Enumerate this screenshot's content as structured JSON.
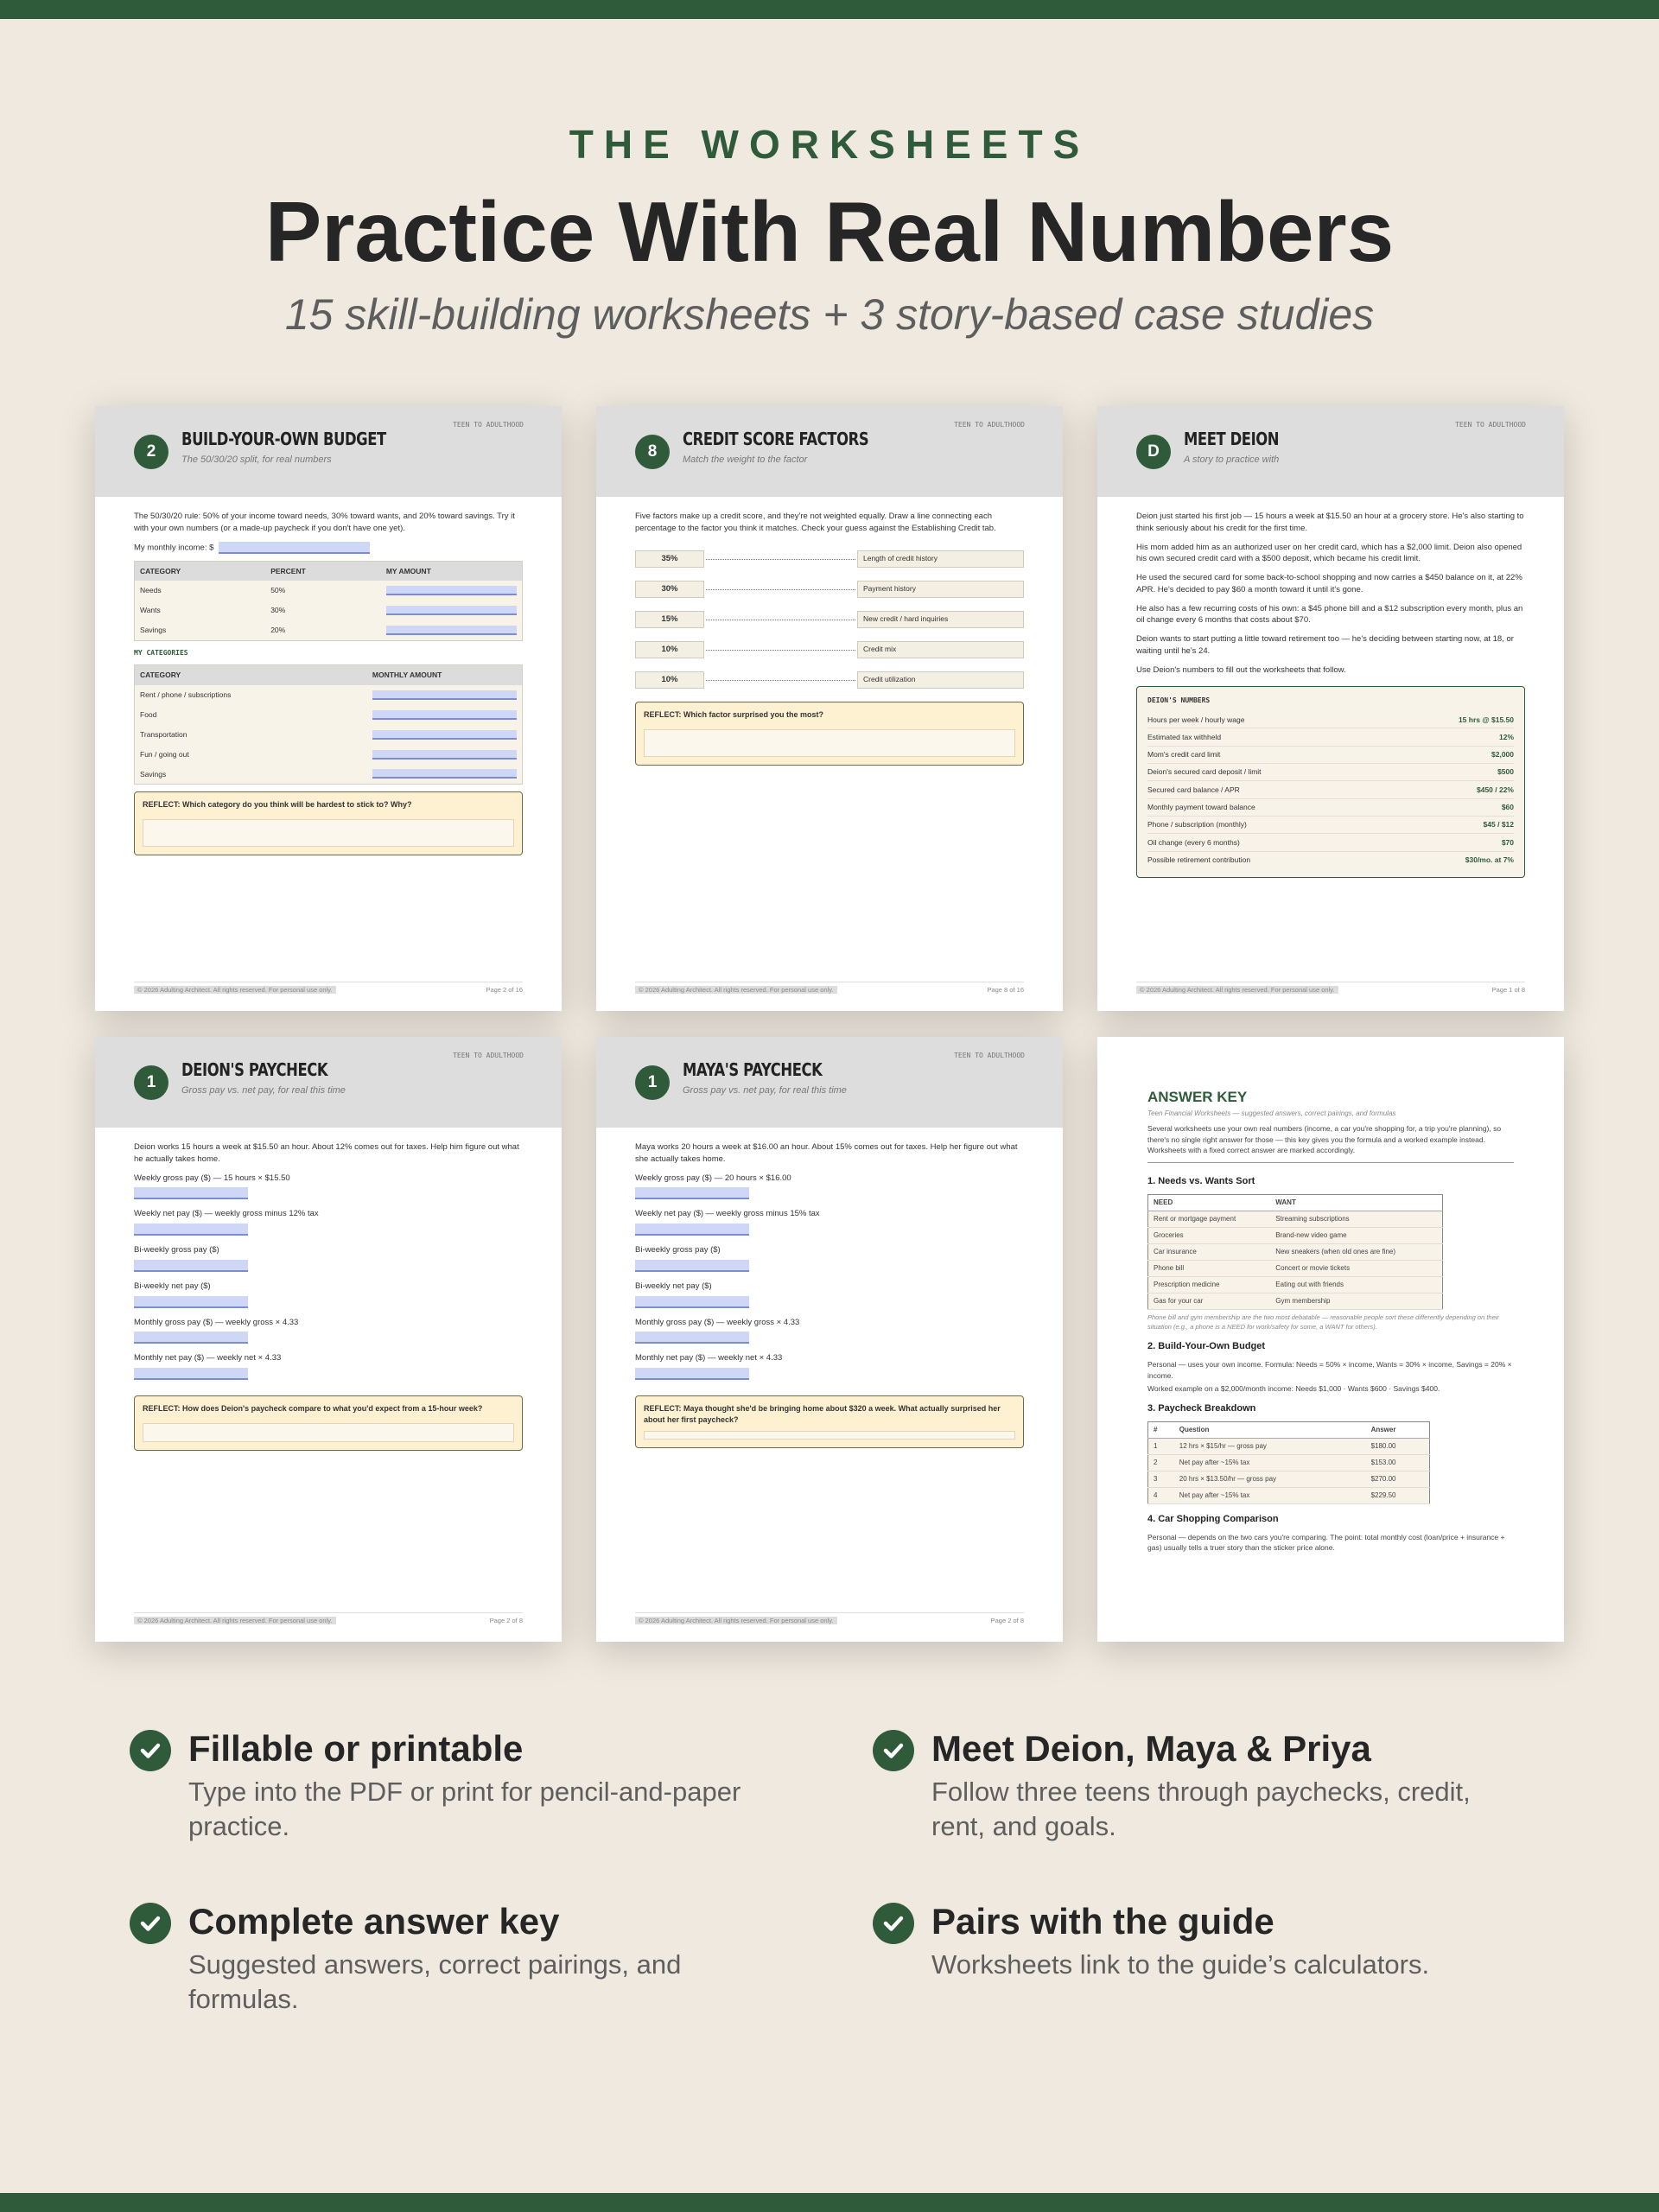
{
  "eyebrow": "THE WORKSHEETS",
  "headline": "Practice With Real Numbers",
  "subhead": "15 skill-building worksheets + 3 story-based case studies",
  "footer_copyright": "© 2026 Adulting Architect. All rights reserved. For personal use only.",
  "sheet_tag": "TEEN TO ADULTHOOD",
  "budget": {
    "badge": "2",
    "title": "BUILD-YOUR-OWN BUDGET",
    "subtitle": "The 50/30/20 split, for real numbers",
    "intro": "The 50/30/20 rule: 50% of your income toward needs, 30% toward wants, and 20% toward savings. Try it with your own numbers (or a made-up paycheck if you don't have one yet).",
    "income_label": "My monthly income: $",
    "col_category": "CATEGORY",
    "col_percent": "PERCENT",
    "col_amount": "MY AMOUNT",
    "rows": [
      {
        "cat": "Needs",
        "pct": "50%"
      },
      {
        "cat": "Wants",
        "pct": "30%"
      },
      {
        "cat": "Savings",
        "pct": "20%"
      }
    ],
    "my_categories": "MY CATEGORIES",
    "col_monthly": "MONTHLY AMOUNT",
    "cat_rows": [
      "Rent / phone / subscriptions",
      "Food",
      "Transportation",
      "Fun / going out",
      "Savings"
    ],
    "reflect": "REFLECT: Which category do you think will be hardest to stick to? Why?",
    "page": "Page 2 of 16"
  },
  "credit": {
    "badge": "8",
    "title": "CREDIT SCORE FACTORS",
    "subtitle": "Match the weight to the factor",
    "intro": "Five factors make up a credit score, and they're not weighted equally. Draw a line connecting each percentage to the factor you think it matches. Check your guess against the Establishing Credit tab.",
    "pairs": [
      {
        "pct": "35%",
        "factor": "Length of credit history"
      },
      {
        "pct": "30%",
        "factor": "Payment history"
      },
      {
        "pct": "15%",
        "factor": "New credit / hard inquiries"
      },
      {
        "pct": "10%",
        "factor": "Credit mix"
      },
      {
        "pct": "10%",
        "factor": "Credit utilization"
      }
    ],
    "reflect": "REFLECT: Which factor surprised you the most?",
    "page": "Page 8 of 16"
  },
  "deion_story": {
    "badge": "D",
    "title": "MEET DEION",
    "subtitle": "A story to practice with",
    "paragraphs": [
      "Deion just started his first job — 15 hours a week at $15.50 an hour at a grocery store. He's also starting to think seriously about his credit for the first time.",
      "His mom added him as an authorized user on her credit card, which has a $2,000 limit. Deion also opened his own secured credit card with a $500 deposit, which became his credit limit.",
      "He used the secured card for some back-to-school shopping and now carries a $450 balance on it, at 22% APR. He's decided to pay $60 a month toward it until it's gone.",
      "He also has a few recurring costs of his own: a $45 phone bill and a $12 subscription every month, plus an oil change every 6 months that costs about $70.",
      "Deion wants to start putting a little toward retirement too — he's deciding between starting now, at 18, or waiting until he's 24.",
      "Use Deion's numbers to fill out the worksheets that follow."
    ],
    "numbers_title": "DEION'S NUMBERS",
    "numbers": [
      {
        "label": "Hours per week / hourly wage",
        "value": "15 hrs @ $15.50"
      },
      {
        "label": "Estimated tax withheld",
        "value": "12%"
      },
      {
        "label": "Mom's credit card limit",
        "value": "$2,000"
      },
      {
        "label": "Deion's secured card deposit / limit",
        "value": "$500"
      },
      {
        "label": "Secured card balance / APR",
        "value": "$450 / 22%"
      },
      {
        "label": "Monthly payment toward balance",
        "value": "$60"
      },
      {
        "label": "Phone / subscription (monthly)",
        "value": "$45 / $12"
      },
      {
        "label": "Oil change (every 6 months)",
        "value": "$70"
      },
      {
        "label": "Possible retirement contribution",
        "value": "$30/mo. at 7%"
      }
    ],
    "page": "Page 1 of 8"
  },
  "deion_pay": {
    "badge": "1",
    "title": "DEION'S PAYCHECK",
    "subtitle": "Gross pay vs. net pay, for real this time",
    "intro": "Deion works 15 hours a week at $15.50 an hour. About 12% comes out for taxes. Help him figure out what he actually takes home.",
    "questions": [
      "Weekly gross pay ($) — 15 hours × $15.50",
      "Weekly net pay ($) — weekly gross minus 12% tax",
      "Bi-weekly gross pay ($)",
      "Bi-weekly net pay ($)",
      "Monthly gross pay ($) — weekly gross × 4.33",
      "Monthly net pay ($) — weekly net × 4.33"
    ],
    "reflect": "REFLECT: How does Deion's paycheck compare to what you'd expect from a 15-hour week?",
    "page": "Page 2 of 8"
  },
  "maya_pay": {
    "badge": "1",
    "title": "MAYA'S PAYCHECK",
    "subtitle": "Gross pay vs. net pay, for real this time",
    "intro": "Maya works 20 hours a week at $16.00 an hour. About 15% comes out for taxes. Help her figure out what she actually takes home.",
    "questions": [
      "Weekly gross pay ($) — 20 hours × $16.00",
      "Weekly net pay ($) — weekly gross minus 15% tax",
      "Bi-weekly gross pay ($)",
      "Bi-weekly net pay ($)",
      "Monthly gross pay ($) — weekly gross × 4.33",
      "Monthly net pay ($) — weekly net × 4.33"
    ],
    "reflect": "REFLECT: Maya thought she'd be bringing home about $320 a week. What actually surprised her about her first paycheck?",
    "page": "Page 2 of 8"
  },
  "answer_key": {
    "title": "ANSWER KEY",
    "subtitle": "Teen Financial Worksheets — suggested answers, correct pairings, and formulas",
    "intro": "Several worksheets use your own real numbers (income, a car you're shopping for, a trip you're planning), so there's no single right answer for those — this key gives you the formula and a worked example instead. Worksheets with a fixed correct answer are marked accordingly.",
    "s1": "1. Needs vs. Wants Sort",
    "need_h": "NEED",
    "want_h": "WANT",
    "pairs": [
      [
        "Rent or mortgage payment",
        "Streaming subscriptions"
      ],
      [
        "Groceries",
        "Brand-new video game"
      ],
      [
        "Car insurance",
        "New sneakers (when old ones are fine)"
      ],
      [
        "Phone bill",
        "Concert or movie tickets"
      ],
      [
        "Prescription medicine",
        "Eating out with friends"
      ],
      [
        "Gas for your car",
        "Gym membership"
      ]
    ],
    "note": "Phone bill and gym membership are the two most debatable — reasonable people sort these differently depending on their situation (e.g., a phone is a NEED for work/safety for some, a WANT for others).",
    "s2": "2. Build-Your-Own Budget",
    "s2_a": "Personal — uses your own income. Formula: Needs = 50% × income, Wants = 30% × income, Savings = 20% × income.",
    "s2_b": "Worked example on a $2,000/month income: Needs $1,000 · Wants $600 · Savings $400.",
    "s3": "3. Paycheck Breakdown",
    "pk_h": [
      "#",
      "Question",
      "Answer"
    ],
    "pk_rows": [
      [
        "1",
        "12 hrs × $15/hr — gross pay",
        "$180.00"
      ],
      [
        "2",
        "Net pay after ~15% tax",
        "$153.00"
      ],
      [
        "3",
        "20 hrs × $13.50/hr — gross pay",
        "$270.00"
      ],
      [
        "4",
        "Net pay after ~15% tax",
        "$229.50"
      ]
    ],
    "s4": "4. Car Shopping Comparison",
    "s4_a": "Personal — depends on the two cars you're comparing. The point: total monthly cost (loan/price + insurance + gas) usually tells a truer story than the sticker price alone."
  },
  "features": [
    {
      "title": "Fillable or printable",
      "desc": "Type into the PDF or print for pencil-and-paper practice."
    },
    {
      "title": "Meet Deion, Maya & Priya",
      "desc": "Follow three teens through paychecks, credit, rent, and goals."
    },
    {
      "title": "Complete answer key",
      "desc": "Suggested answers, correct pairings, and formulas."
    },
    {
      "title": "Pairs with the guide",
      "desc": "Worksheets link to the guide’s calculators."
    }
  ]
}
